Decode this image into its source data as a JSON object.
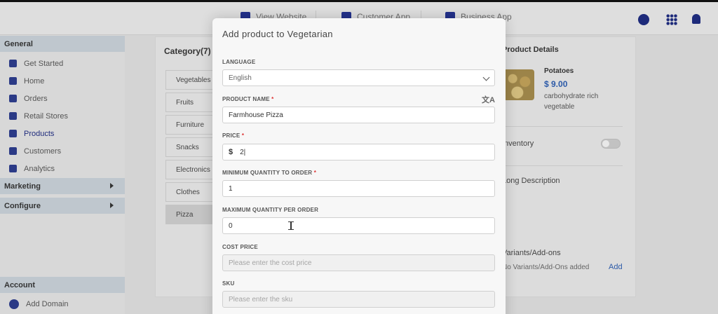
{
  "topbar": {
    "links": [
      "View Website",
      "Customer App",
      "Business App"
    ]
  },
  "sidebar": {
    "general_label": "General",
    "items": [
      {
        "label": "Get Started",
        "icon": "document-icon"
      },
      {
        "label": "Home",
        "icon": "home-icon"
      },
      {
        "label": "Orders",
        "icon": "orders-icon"
      },
      {
        "label": "Retail Stores",
        "icon": "store-icon"
      },
      {
        "label": "Products",
        "icon": "products-icon"
      },
      {
        "label": "Customers",
        "icon": "customers-icon"
      },
      {
        "label": "Analytics",
        "icon": "analytics-icon"
      }
    ],
    "marketing_label": "Marketing",
    "configure_label": "Configure",
    "account_label": "Account",
    "add_domain_label": "Add Domain"
  },
  "categories": {
    "title": "Category(7)",
    "items": [
      "Vegetables",
      "Fruits",
      "Furniture",
      "Snacks",
      "Electronics",
      "Clothes",
      "Pizza"
    ]
  },
  "product_details": {
    "title": "Product Details",
    "name": "Potatoes",
    "price": "$ 9.00",
    "description": "carbohydrate rich vegetable",
    "inventory_label": "Inventory",
    "long_description_label": "Long Description",
    "variants_label": "Variants/Add-ons",
    "variants_sub": "No Variants/Add-Ons added",
    "add_label": "Add"
  },
  "modal": {
    "title": "Add product to Vegetarian",
    "language_label": "LANGUAGE",
    "language_value": "English",
    "product_name_label": "PRODUCT NAME",
    "product_name_value": "Farmhouse Pizza",
    "price_label": "PRICE",
    "price_currency": "$",
    "price_value": "2|",
    "min_qty_label": "MINIMUM QUANTITY TO ORDER",
    "min_qty_value": "1",
    "max_qty_label": "MAXIMUM QUANTITY PER ORDER",
    "max_qty_value": "0",
    "cost_price_label": "COST PRICE",
    "cost_price_placeholder": "Please enter the cost price",
    "sku_label": "SKU",
    "sku_placeholder": "Please enter the sku",
    "required_mark": "*"
  },
  "colors": {
    "brand": "#1d2a7a",
    "price": "#2c5aa8",
    "required": "#dd3333"
  }
}
